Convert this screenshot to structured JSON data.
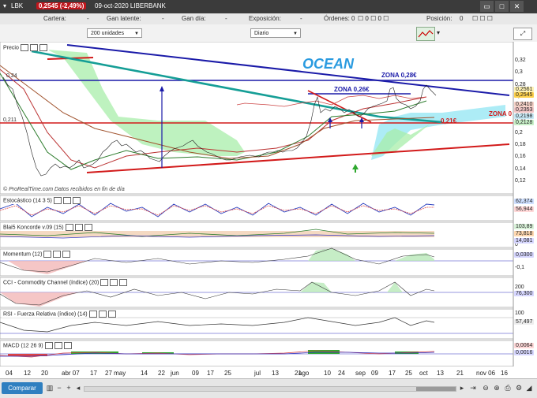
{
  "titlebar": {
    "ticker": "LBK",
    "price_change": "0,2545 (-2,49%)",
    "date_name": "09-oct-2020 LIBERBANK"
  },
  "infobar": {
    "bid_label": "Cartera:",
    "bid_val": "-",
    "latent_label": "Gan latente:",
    "latent_val": "-",
    "day_label": "Gan día:",
    "day_val": "-",
    "exposure_label": "Exposición:",
    "exposure_val": "-",
    "orders_label": "Órdenes:",
    "orders_val": "0",
    "position_label": "Posición:",
    "position_val": "0"
  },
  "toolbar": {
    "units": "200 unidades",
    "interval": "Diario"
  },
  "panels": {
    "price": "Precio",
    "stoch": "Estocástico (14 3 5)",
    "blai": "Blai5 Koncorde v.09 (15)",
    "momentum": "Momentum (12)",
    "cci": "CCI - Commodity Channel (índice) (20)",
    "rsi": "RSI - Fuerza Relativa (índice) (14)",
    "macd": "MACD (12 26 9)"
  },
  "annotations": {
    "ocean": "OCEAN",
    "zona028": "ZONA 0,28€",
    "zona026": "ZONA 0,26€",
    "zona021": "0,21€",
    "zona_right": "ZONA 0",
    "price_left1": "0,24",
    "price_left2": "0,211",
    "watermark": "© ProRealTime.com Datos recibidos en fin de día"
  },
  "price_axis": [
    "0,32",
    "0,3",
    "0,28",
    "0,26",
    "0,24",
    "0,22",
    "0,2",
    "0,18",
    "0,16",
    "0,14",
    "0,12"
  ],
  "price_tags": [
    {
      "text": "0,2561",
      "color": "#fff2b3"
    },
    {
      "text": "0,2545",
      "color": "#ffd24d"
    },
    {
      "text": "0,2410",
      "color": "#f6d2c8"
    },
    {
      "text": "0,2353",
      "color": "#f0c6c6"
    },
    {
      "text": "0,2198",
      "color": "#c6e8f5"
    },
    {
      "text": "0,2128",
      "color": "#c8f0c8"
    }
  ],
  "stoch_tags": [
    {
      "text": "62,374",
      "color": "#cfe0ff"
    },
    {
      "text": "56,944",
      "color": "#ffd8d8"
    }
  ],
  "blai_tags": [
    {
      "text": "103,89",
      "color": "#d9f2d9"
    },
    {
      "text": "73,818",
      "color": "#ffd8b0"
    },
    {
      "text": "14,081",
      "color": "#d7d7ff"
    }
  ],
  "momentum_axis": [
    "0",
    "-0,1"
  ],
  "momentum_tag": "0,0300",
  "cci_axis": [
    "200",
    "100"
  ],
  "cci_tag": "76,300",
  "rsi_axis": [
    "100"
  ],
  "rsi_tag": "57,497",
  "macd_tags": [
    {
      "text": "0,0064",
      "color": "#ffd8d8"
    },
    {
      "text": "0,0016",
      "color": "#d7d7ff"
    }
  ],
  "xaxis": [
    "04",
    "12",
    "20",
    "abr 07",
    "17",
    "27 may",
    "14",
    "22",
    "jun",
    "09",
    "17",
    "25",
    "jul",
    "13",
    "21",
    "ago",
    "10",
    "24",
    "sep",
    "09",
    "17",
    "25",
    "oct",
    "13",
    "21",
    "nov 06",
    "16"
  ],
  "bottombar": {
    "compare": "Comparar"
  }
}
